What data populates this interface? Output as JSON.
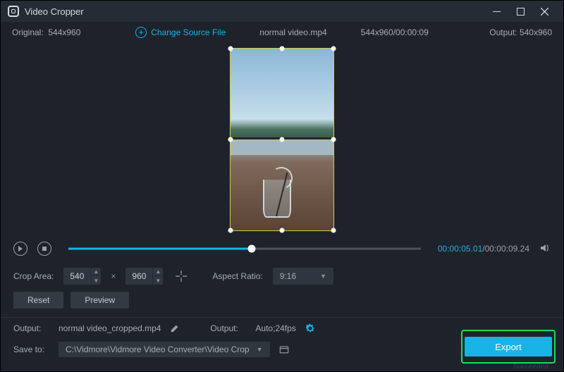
{
  "titlebar": {
    "title": "Video Cropper"
  },
  "strip": {
    "original_label": "Original:",
    "original_value": "544x960",
    "change_source_label": "Change Source File",
    "file_name": "normal video.mp4",
    "source_info": "544x960/00:00:09",
    "output_label": "Output:",
    "output_value": "540x960"
  },
  "timeline": {
    "current": "00:00:05.01",
    "total": "00:00:09.24"
  },
  "controls": {
    "crop_area_label": "Crop Area:",
    "width": "540",
    "height": "960",
    "aspect_label": "Aspect Ratio:",
    "aspect_value": "9:16"
  },
  "buttons": {
    "reset": "Reset",
    "preview": "Preview",
    "export": "Export"
  },
  "output": {
    "label": "Output:",
    "file": "normal video_cropped.mp4",
    "fmt_label": "Output:",
    "fmt_value": "Auto;24fps"
  },
  "save": {
    "label": "Save to:",
    "path": "C:\\Vidmore\\Vidmore Video Converter\\Video Crop"
  },
  "status": {
    "succeeded": "Succeeded"
  }
}
